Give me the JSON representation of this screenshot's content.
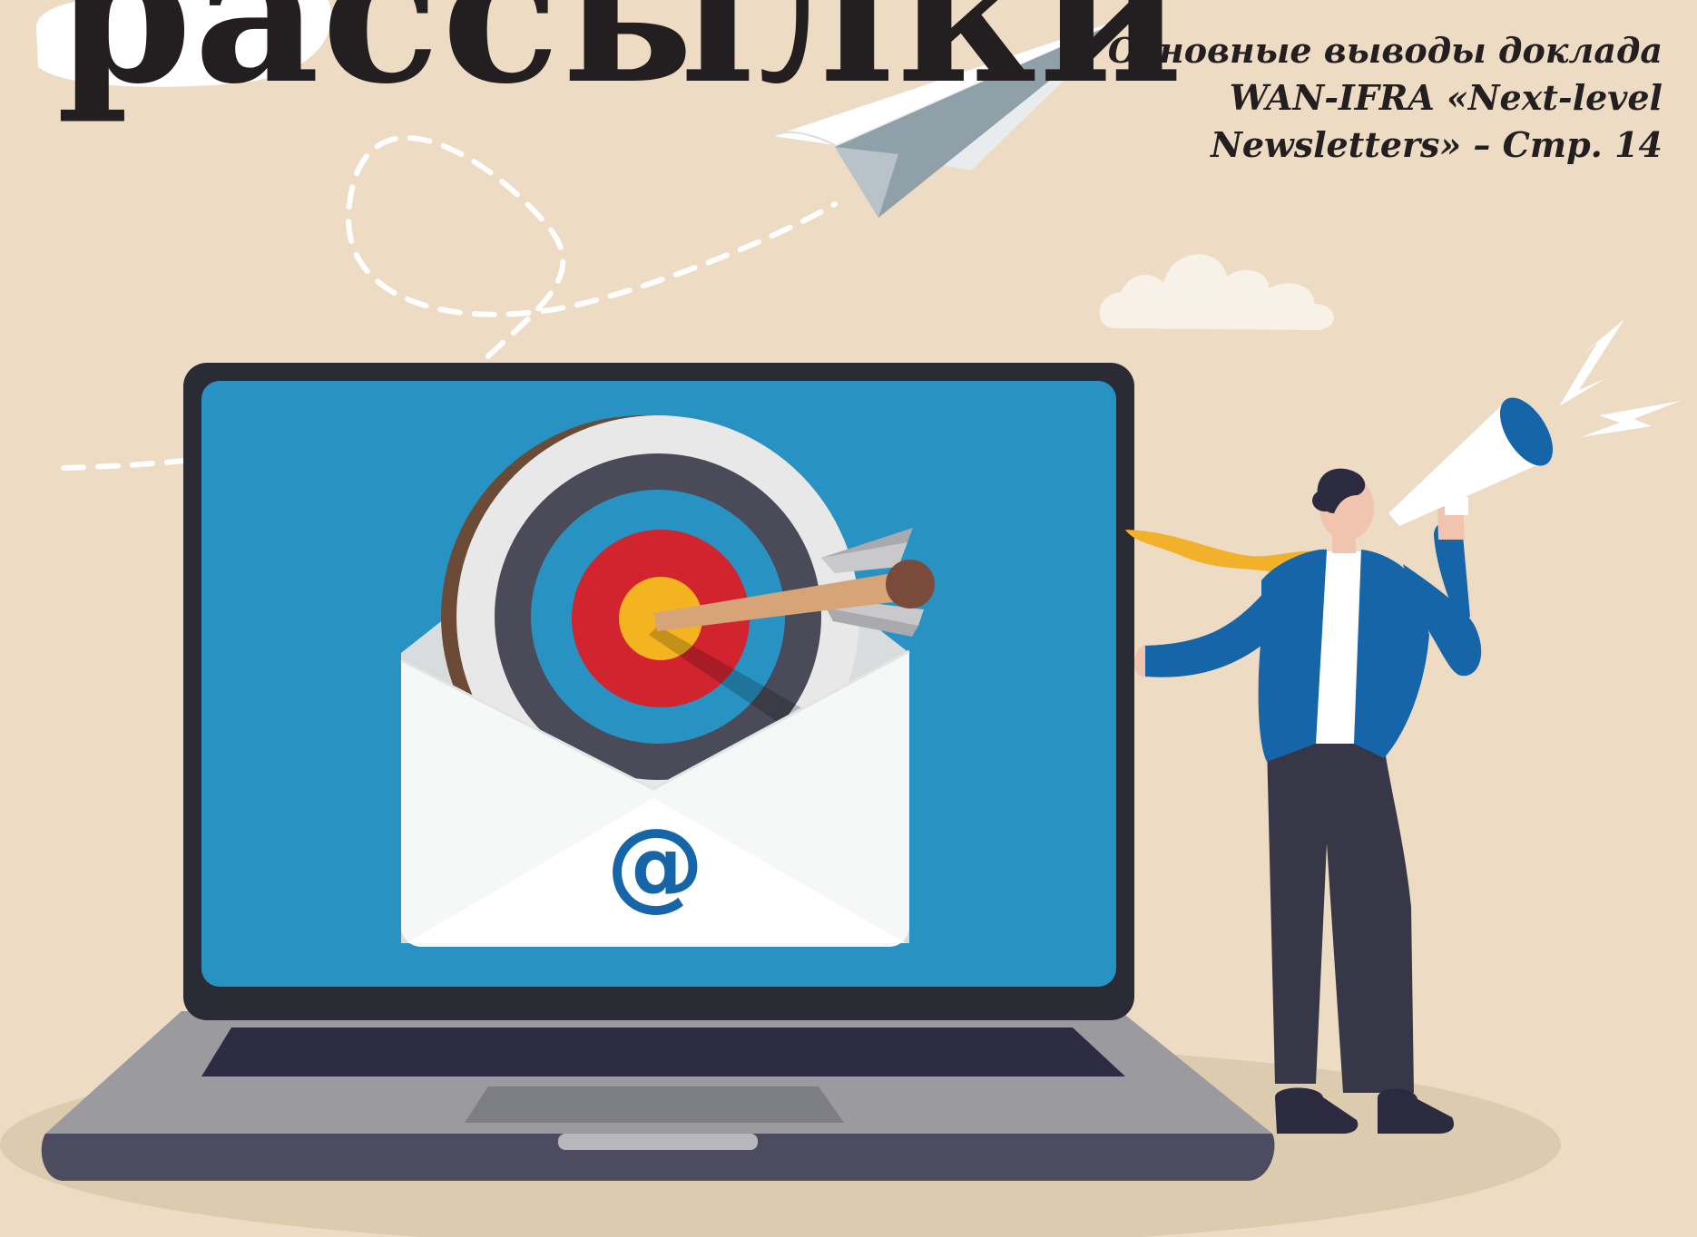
{
  "headline": "рассылки",
  "teaser": {
    "lines": [
      "Основные выводы доклада",
      "WAN-IFRA «Next-level",
      "Newsletters» – Стр. 14"
    ]
  },
  "illustration": {
    "email_symbol": "@",
    "icons": [
      "paper-plane-icon",
      "target-icon",
      "arrow-icon",
      "envelope-icon",
      "laptop-icon",
      "megaphone-icon",
      "cloud-icon",
      "businessman-figure"
    ]
  },
  "colors": {
    "background": "#eddbc4",
    "screen_blue": "#2892c2",
    "target_red": "#d1242f",
    "target_yellow": "#f4b41f",
    "suit_blue": "#1565a8",
    "tie_yellow": "#f2b12a",
    "text": "#231f20"
  }
}
